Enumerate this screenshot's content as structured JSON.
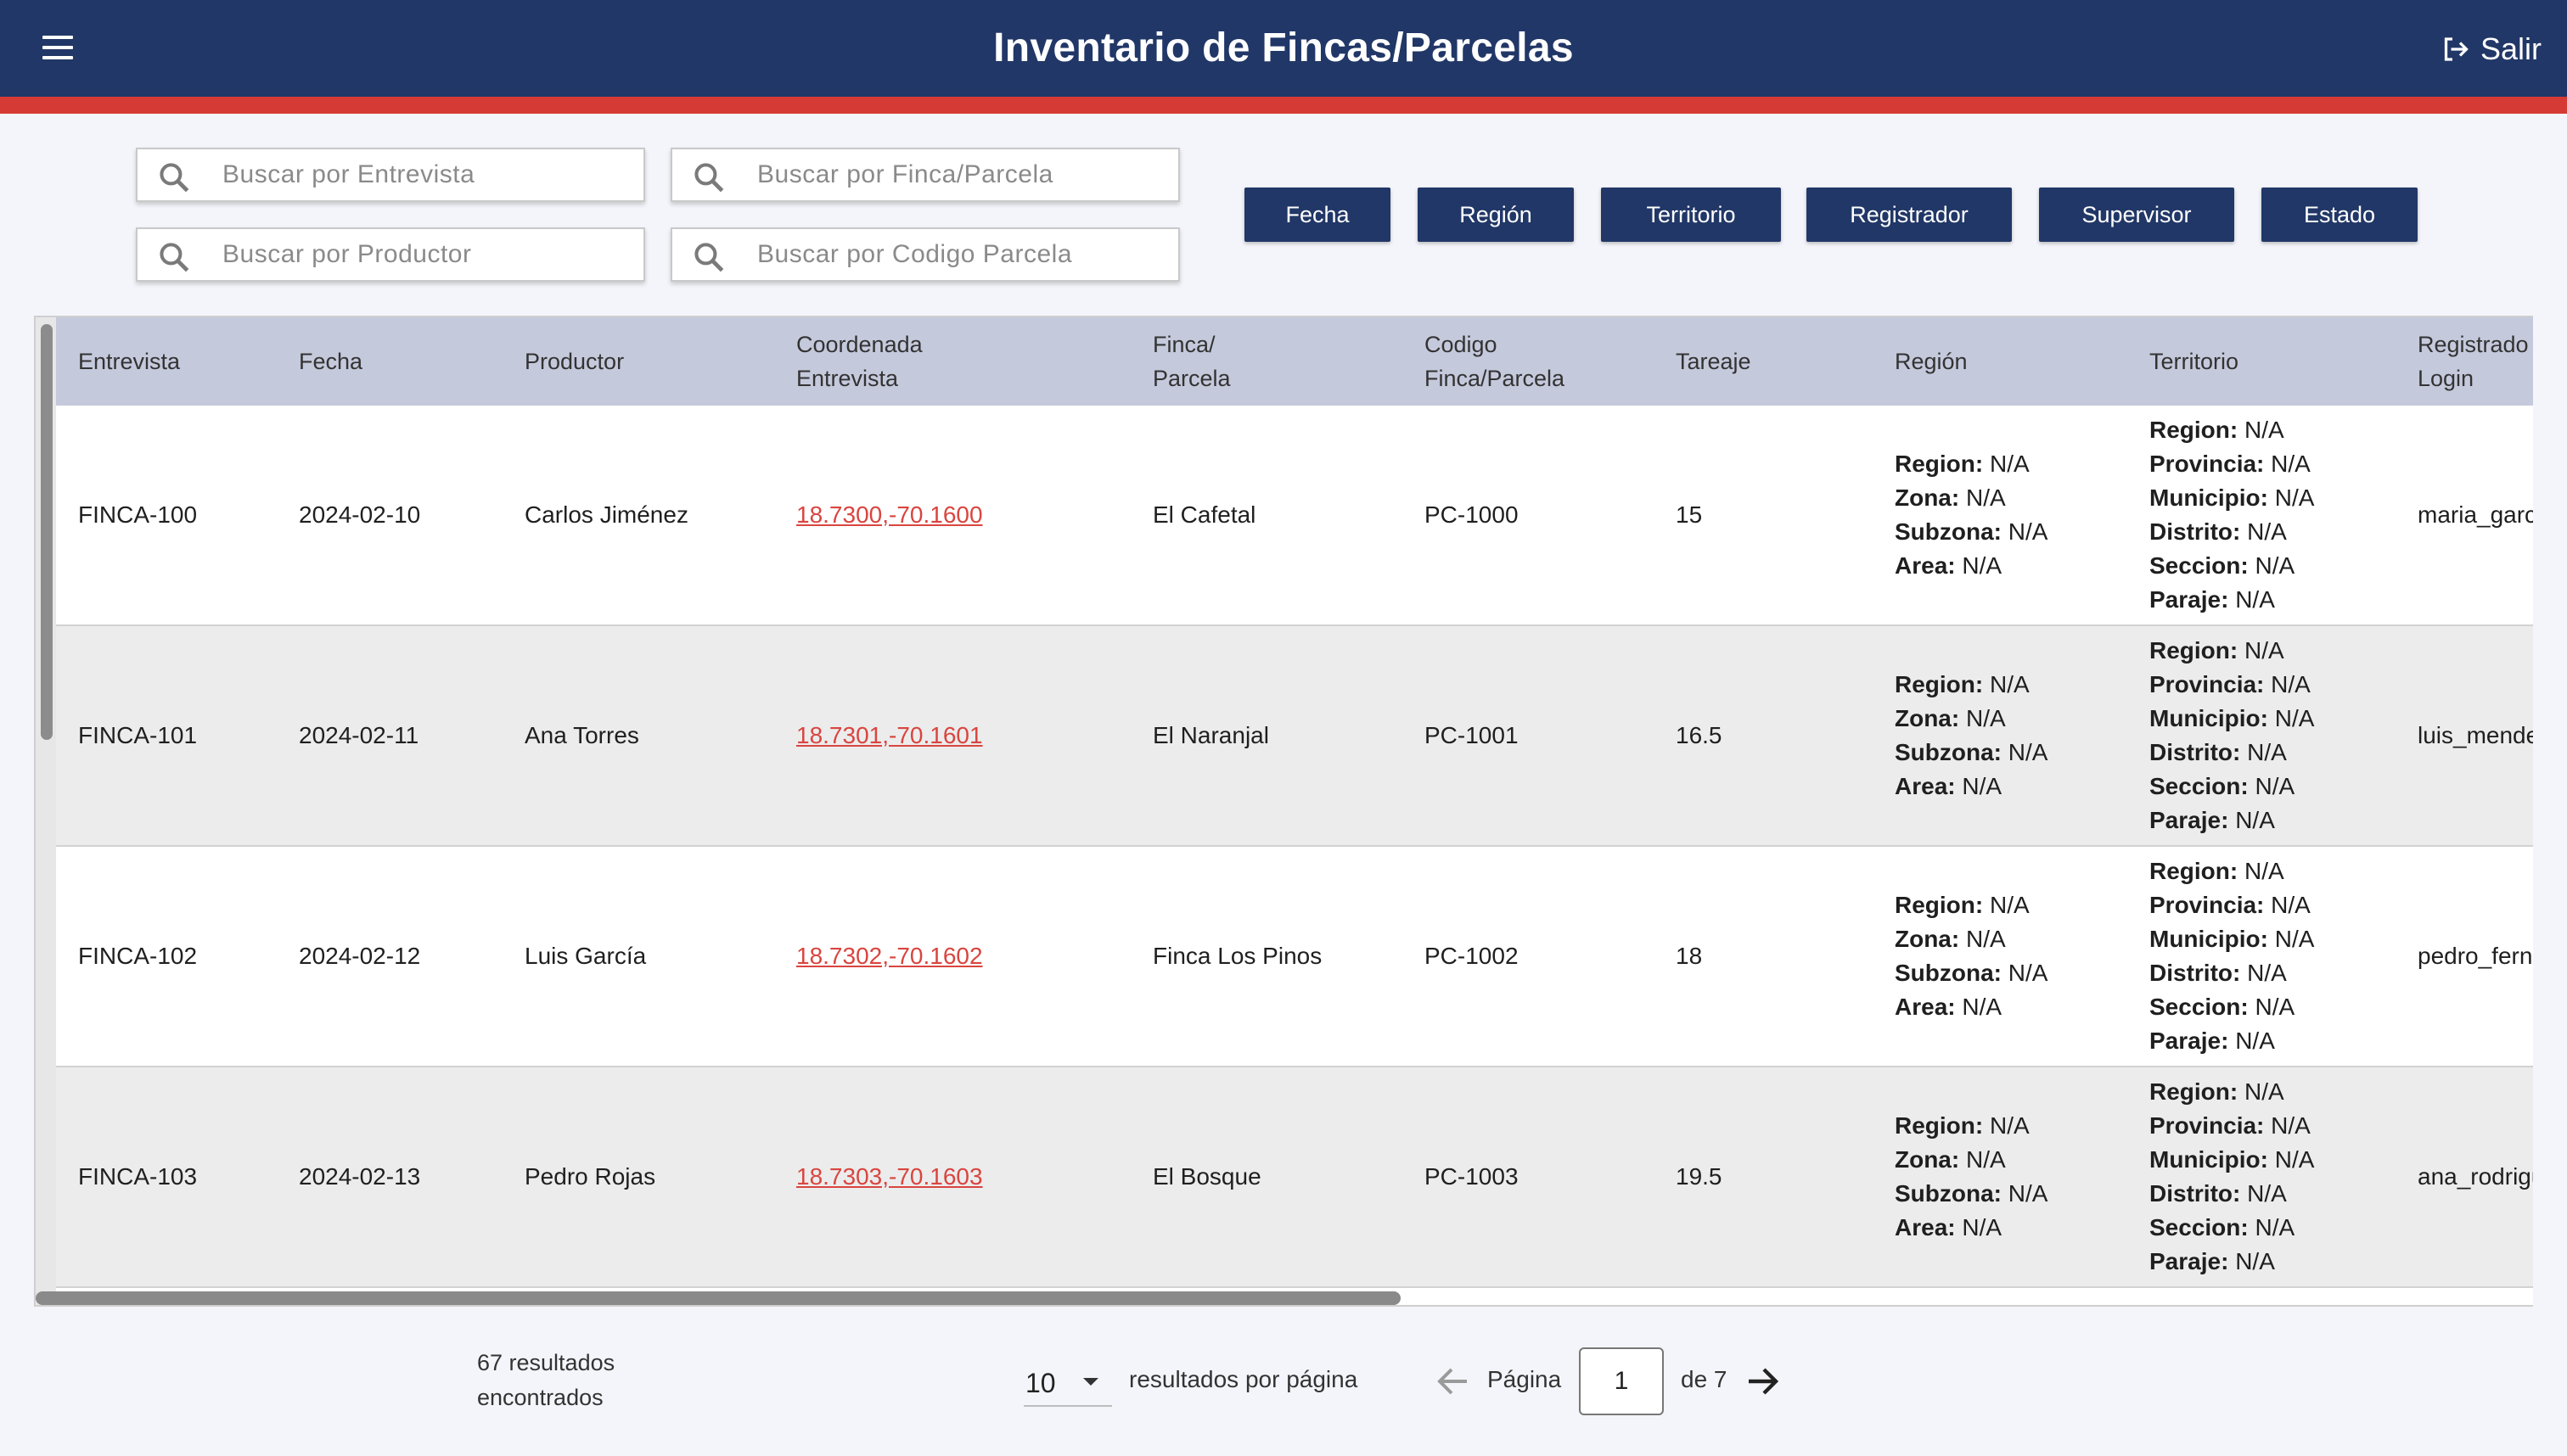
{
  "header": {
    "title": "Inventario de Fincas/Parcelas",
    "logout_label": "Salir",
    "bg_color": "#213767",
    "accent_color": "#d63a35"
  },
  "search": {
    "entrevista_placeholder": "Buscar por Entrevista",
    "finca_placeholder": "Buscar por Finca/Parcela",
    "productor_placeholder": "Buscar por Productor",
    "codigo_placeholder": "Buscar por Codigo Parcela"
  },
  "filters": [
    "Fecha",
    "Región",
    "Territorio",
    "Registrador",
    "Supervisor",
    "Estado"
  ],
  "table": {
    "columns": [
      {
        "l1": "Entrevista",
        "l2": ""
      },
      {
        "l1": "Fecha",
        "l2": ""
      },
      {
        "l1": "Productor",
        "l2": ""
      },
      {
        "l1": "Coordenada",
        "l2": "Entrevista"
      },
      {
        "l1": "Finca/",
        "l2": "Parcela"
      },
      {
        "l1": "Codigo",
        "l2": "Finca/Parcela"
      },
      {
        "l1": "Tareaje",
        "l2": ""
      },
      {
        "l1": "Región",
        "l2": ""
      },
      {
        "l1": "Territorio",
        "l2": ""
      },
      {
        "l1": "Registrado",
        "l2": "Login"
      }
    ],
    "region_keys": [
      "Region:",
      "Zona:",
      "Subzona:",
      "Area:"
    ],
    "territorio_keys": [
      "Region:",
      "Provincia:",
      "Municipio:",
      "Distrito:",
      "Seccion:",
      "Paraje:"
    ],
    "na": "N/A",
    "rows": [
      {
        "entrevista": "FINCA-100",
        "fecha": "2024-02-10",
        "productor": "Carlos Jiménez",
        "coordenada": "18.7300,-70.1600",
        "finca": "El Cafetal",
        "codigo": "PC-1000",
        "tareaje": "15",
        "login": "maria_garcia"
      },
      {
        "entrevista": "FINCA-101",
        "fecha": "2024-02-11",
        "productor": "Ana Torres",
        "coordenada": "18.7301,-70.1601",
        "finca": "El Naranjal",
        "codigo": "PC-1001",
        "tareaje": "16.5",
        "login": "luis_mendez"
      },
      {
        "entrevista": "FINCA-102",
        "fecha": "2024-02-12",
        "productor": "Luis García",
        "coordenada": "18.7302,-70.1602",
        "finca": "Finca Los Pinos",
        "codigo": "PC-1002",
        "tareaje": "18",
        "login": "pedro_fernandez"
      },
      {
        "entrevista": "FINCA-103",
        "fecha": "2024-02-13",
        "productor": "Pedro Rojas",
        "coordenada": "18.7303,-70.1603",
        "finca": "El Bosque",
        "codigo": "PC-1003",
        "tareaje": "19.5",
        "login": "ana_rodriguez"
      }
    ]
  },
  "footer": {
    "results_line1": "67 resultados",
    "results_line2": "encontrados",
    "per_page": "10",
    "per_page_label": "resultados por página",
    "pagina_label": "Página",
    "current_page": "1",
    "of_label": "de 7"
  }
}
